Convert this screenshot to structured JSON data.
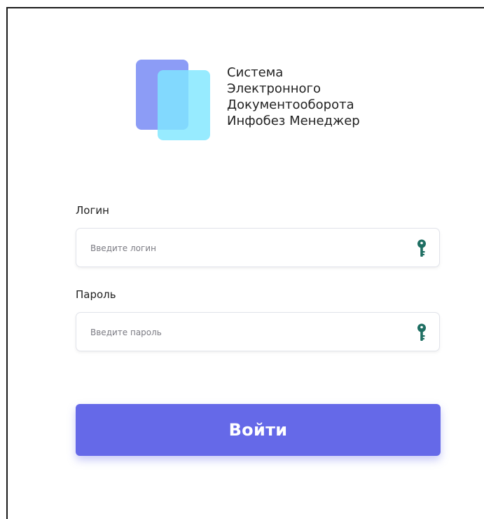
{
  "logo": {
    "icon_name": "stacked-squares-logo",
    "colors": {
      "back": "#8c9cf6",
      "front": "#80e6ff"
    }
  },
  "title": {
    "line1": "Система",
    "line2": "Электронного",
    "line3": "Документооборота",
    "line4": "Инфобез Менеджер"
  },
  "form": {
    "login": {
      "label": "Логин",
      "placeholder": "Введите логин",
      "value": "",
      "icon_name": "key-icon"
    },
    "password": {
      "label": "Пароль",
      "placeholder": "Введите пароль",
      "value": "",
      "icon_name": "key-icon"
    },
    "submit_label": "Войти"
  },
  "colors": {
    "accent": "#6569e8",
    "key": "#1f6f63"
  }
}
